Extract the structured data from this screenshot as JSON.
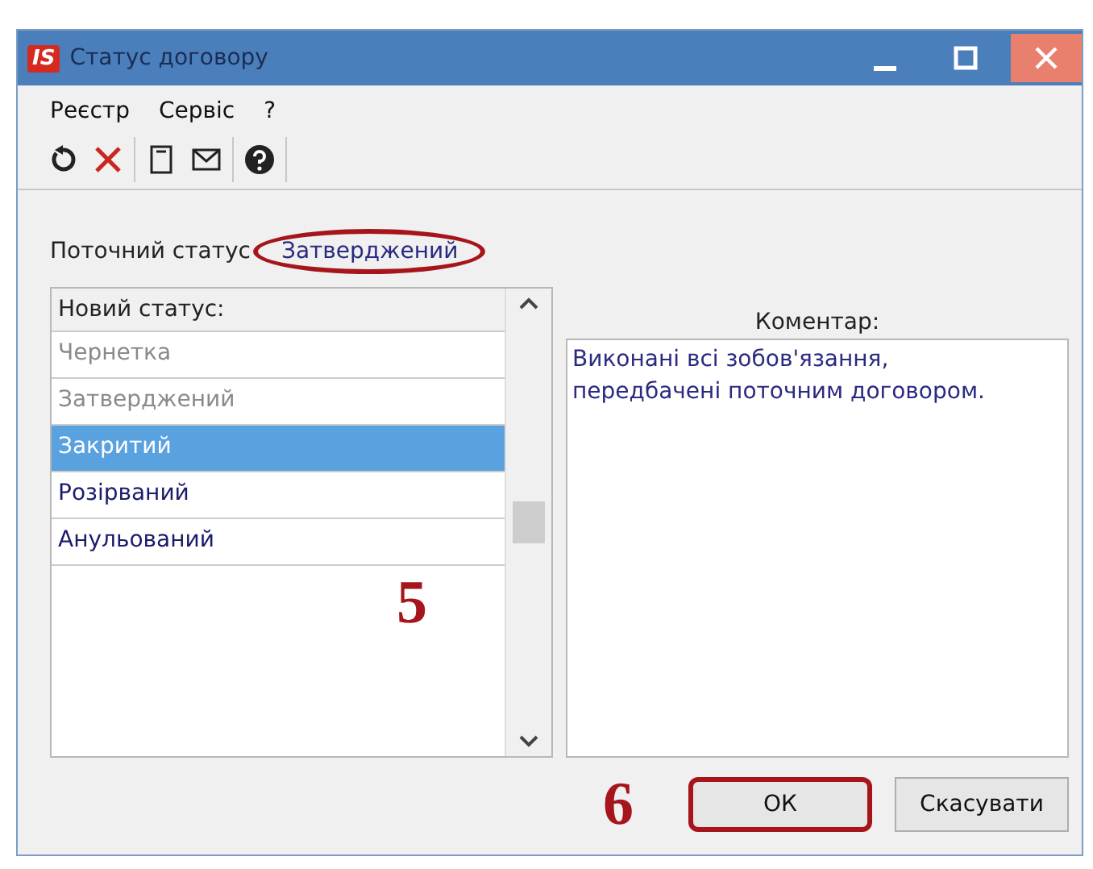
{
  "window": {
    "title": "Статус договору",
    "logo": "IS"
  },
  "menu": [
    "Реєстр",
    "Сервіс",
    "?"
  ],
  "current_status": {
    "label": "Поточний статус",
    "value": "Затверджений",
    "circled": true
  },
  "status_list": {
    "header": "Новий статус:",
    "step_marker": "5",
    "items": [
      {
        "label": "Чернетка",
        "disabled": true,
        "selected": false
      },
      {
        "label": "Затверджений",
        "disabled": true,
        "selected": false
      },
      {
        "label": "Закритий",
        "disabled": false,
        "selected": true
      },
      {
        "label": "Розірваний",
        "disabled": false,
        "selected": false
      },
      {
        "label": "Анульований",
        "disabled": false,
        "selected": false
      }
    ]
  },
  "comment": {
    "label": "Коментар:",
    "value": "Виконані всі зобов'язання,\nпередбачені поточним договором."
  },
  "footer": {
    "step_marker": "6",
    "buttons": [
      {
        "label": "ОК",
        "kind": "ok",
        "circled": true
      },
      {
        "label": "Скасувати",
        "kind": "cancel",
        "circled": false
      }
    ]
  }
}
